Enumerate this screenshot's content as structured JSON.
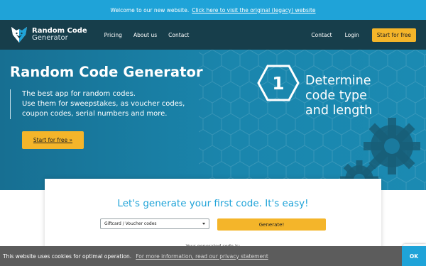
{
  "announcement": {
    "prefix": "Welcome to our new website.",
    "link": "Click here to visit the original (legacy) website"
  },
  "nav": {
    "logo_line1": "Random Code",
    "logo_line2": "Generator",
    "links_left": [
      "Pricing",
      "About us",
      "Contact"
    ],
    "links_right": [
      "Contact",
      "Login"
    ],
    "cta": "Start for free"
  },
  "hero": {
    "title": "Random Code Generator",
    "desc_lines": [
      "The best app for random codes.",
      "Use them for sweepstakes, as voucher codes,",
      "coupon codes, serial numbers and more."
    ],
    "cta": "Start for free »",
    "step_number": "1",
    "step_lines": [
      "Determine",
      "code type",
      "and length"
    ]
  },
  "generator": {
    "title": "Let's generate your first code. It's easy!",
    "select_value": "Giftcard / Voucher codes",
    "button": "Generate!",
    "result_label": "Your generated code is:"
  },
  "cookie": {
    "text": "This website uses cookies for optimal operation.",
    "link": "For more information, read our privacy statement",
    "ok": "OK"
  },
  "colors": {
    "accent": "#1fa3d8",
    "nav": "#173e4b",
    "button": "#f4b52a"
  }
}
